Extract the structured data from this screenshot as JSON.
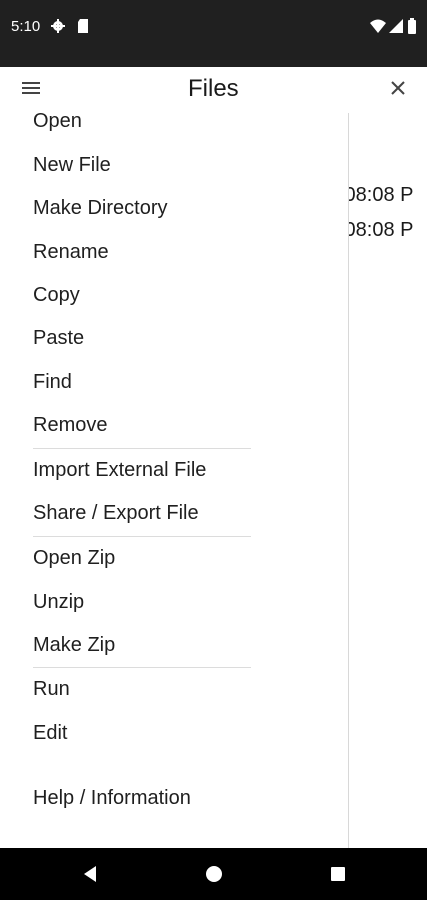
{
  "status_bar": {
    "time": "5:10",
    "icons": [
      "gear-icon",
      "sd-card-icon",
      "wifi-icon",
      "signal-icon",
      "battery-icon"
    ]
  },
  "header": {
    "title": "Files",
    "menu_icon": "hamburger-menu-icon",
    "close_icon": "close-icon"
  },
  "background": {
    "timestamps": [
      ":08:08 P",
      ":08:08 P"
    ]
  },
  "menu": {
    "items": [
      "Open",
      "New File",
      "Make Directory",
      "Rename",
      "Copy",
      "Paste",
      "Find",
      "Remove",
      "Import External File",
      "Share / Export File",
      "Open Zip",
      "Unzip",
      "Make Zip",
      "Run",
      "Edit",
      "Help / Information"
    ]
  },
  "nav_bar": {
    "buttons": [
      "back-icon",
      "home-icon",
      "recents-icon"
    ]
  },
  "colors": {
    "status_bar": "#202020",
    "nav_bar": "#000000",
    "text": "#1f1f1f",
    "divider": "#dcdcdc"
  }
}
